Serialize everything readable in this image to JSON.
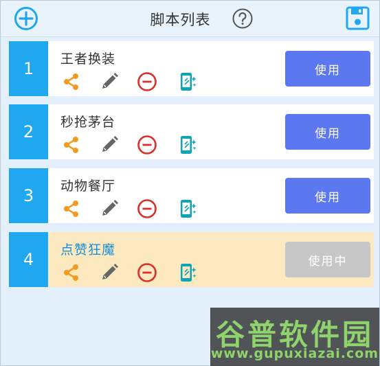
{
  "header": {
    "title": "脚本列表",
    "add_icon": "plus-circle-icon",
    "help_icon": "question-circle-icon",
    "save_icon": "floppy-disk-icon"
  },
  "scripts": [
    {
      "index": "1",
      "name": "王者换装",
      "button_label": "使用",
      "active": false
    },
    {
      "index": "2",
      "name": "秒抢茅台",
      "button_label": "使用",
      "active": false
    },
    {
      "index": "3",
      "name": "动物餐厅",
      "button_label": "使用",
      "active": false
    },
    {
      "index": "4",
      "name": "点赞狂魔",
      "button_label": "使用中",
      "active": true
    }
  ],
  "icons": {
    "share": "share-icon",
    "edit": "pencil-icon",
    "delete": "minus-circle-icon",
    "run": "phone-sparkle-icon"
  },
  "colors": {
    "accent": "#1fa7ef",
    "button": "#5b78f0",
    "button_inuse": "#c7c7c7",
    "share": "#f39a1e",
    "delete": "#d9302b",
    "run": "#0fa3b8",
    "active_bg": "#fde9bf"
  },
  "watermark": {
    "text": "谷普软件园",
    "url": "www.gupuxiazai.com"
  }
}
